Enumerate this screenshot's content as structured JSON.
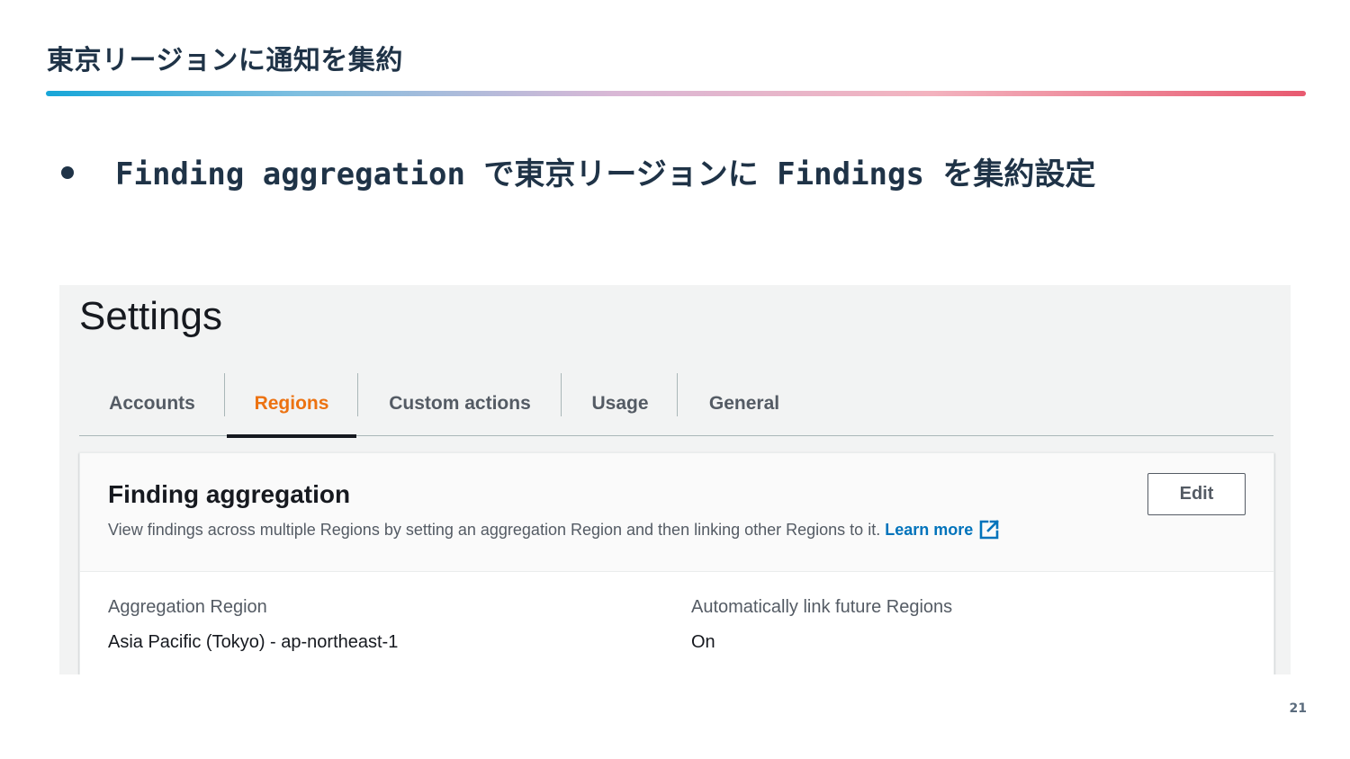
{
  "slide": {
    "title": "東京リージョンに通知を集約",
    "bullet": "Finding aggregation で東京リージョンに Findings を集約設定",
    "page_number": "21"
  },
  "screenshot": {
    "heading": "Settings",
    "tabs": [
      {
        "label": "Accounts",
        "active": false
      },
      {
        "label": "Regions",
        "active": true
      },
      {
        "label": "Custom actions",
        "active": false
      },
      {
        "label": "Usage",
        "active": false
      },
      {
        "label": "General",
        "active": false
      }
    ],
    "panel": {
      "title": "Finding aggregation",
      "description": "View findings across multiple Regions by setting an aggregation Region and then linking other Regions to it.",
      "learn_more": "Learn more",
      "edit_label": "Edit",
      "fields": [
        {
          "label": "Aggregation Region",
          "value": "Asia Pacific (Tokyo) - ap-northeast-1"
        },
        {
          "label": "Automatically link future Regions",
          "value": "On"
        }
      ]
    }
  },
  "colors": {
    "accent_tab": "#ec7211",
    "link": "#0073bb",
    "title_text": "#1f3347",
    "rule_gradient": [
      "#17a6d8",
      "#d9b8d6",
      "#e85a70"
    ]
  },
  "icons": [
    "external-link-icon",
    "bullet-dot"
  ]
}
